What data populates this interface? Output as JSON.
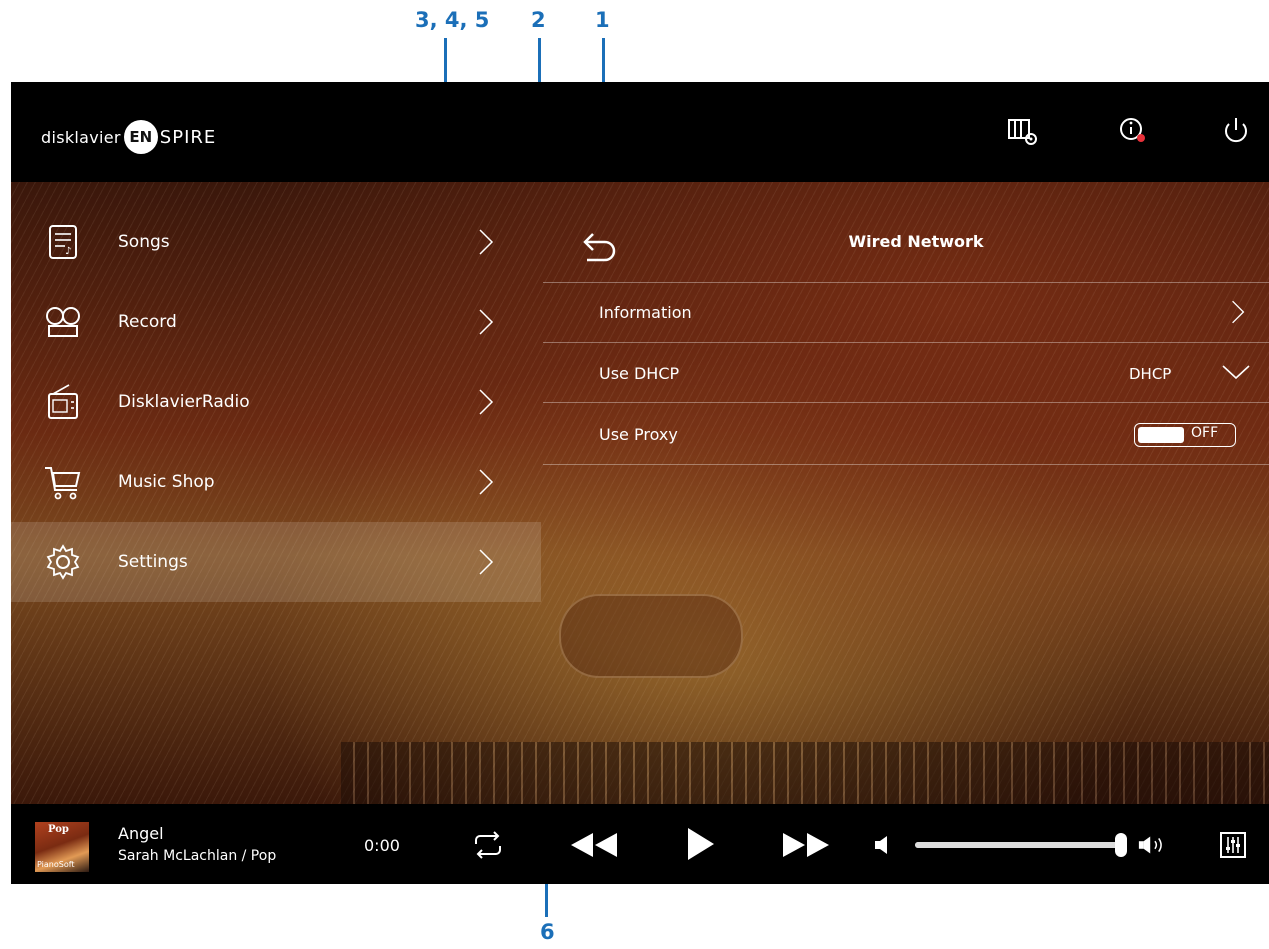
{
  "callouts": {
    "c1": "1",
    "c2": "2",
    "c345": "3, 4, 5",
    "c6": "6"
  },
  "app": {
    "logo_left": "disklavier",
    "logo_en": "EN",
    "logo_right": "SPIRE"
  },
  "header_icons": [
    "piano-settings-icon",
    "info-icon",
    "power-icon"
  ],
  "sidebar": {
    "items": [
      {
        "label": "Songs",
        "icon": "songs-icon"
      },
      {
        "label": "Record",
        "icon": "record-icon"
      },
      {
        "label": "DisklavierRadio",
        "icon": "radio-icon"
      },
      {
        "label": "Music Shop",
        "icon": "shopping-cart-icon"
      },
      {
        "label": "Settings",
        "icon": "gear-icon",
        "active": true
      }
    ]
  },
  "panel": {
    "title": "Wired Network",
    "rows": [
      {
        "label": "Information"
      },
      {
        "label": "Use DHCP",
        "value": "DHCP"
      },
      {
        "label": "Use Proxy",
        "toggle": "OFF"
      }
    ]
  },
  "player": {
    "album_genre": "Pop",
    "album_brand": "PianoSoft",
    "song": "Angel",
    "artist": "Sarah McLachlan / Pop",
    "time": "0:00",
    "volume_level": 1.0
  },
  "colors": {
    "callout": "#1b6fb8",
    "topbar": "#000000",
    "notification_dot": "#e8313a"
  }
}
